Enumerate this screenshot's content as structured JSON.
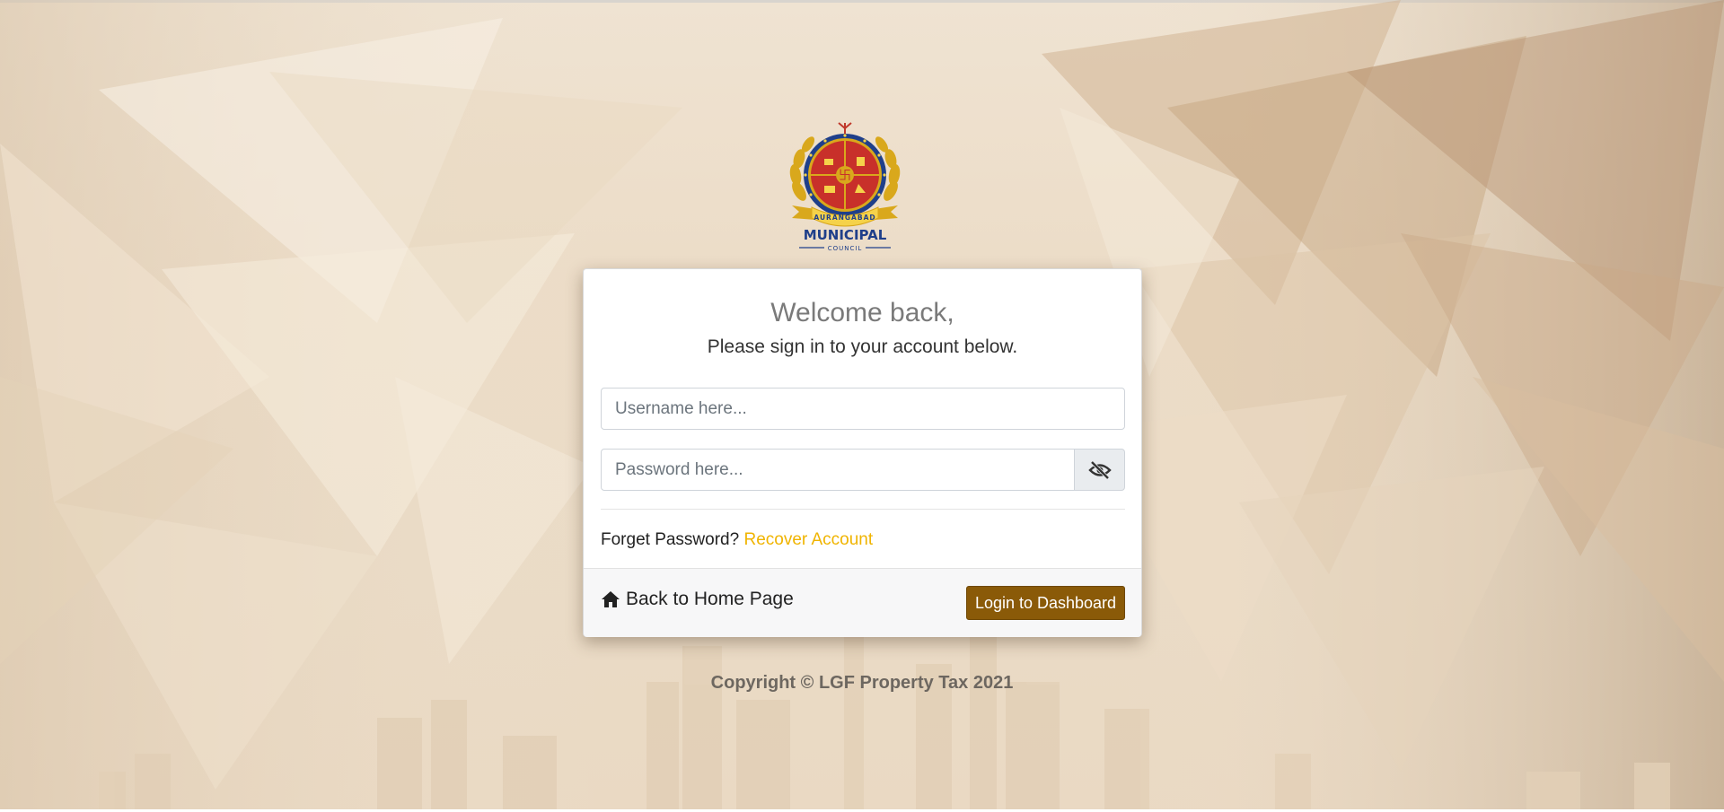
{
  "logo": {
    "icon": "aurangabad-municipal-council-emblem",
    "ribbon_text": "AURANGABAD",
    "name": "MUNICIPAL",
    "sub": "COUNCIL"
  },
  "login": {
    "welcome": "Welcome back,",
    "subtitle": "Please sign in to your account below.",
    "username_placeholder": "Username here...",
    "password_placeholder": "Password here...",
    "toggle_icon": "eye-slash-icon",
    "forgot_label": "Forget Password?",
    "recover_label": "Recover Account",
    "home_icon": "home-icon",
    "home_label": "Back to Home Page",
    "login_button": "Login to Dashboard"
  },
  "footer": {
    "copyright": "Copyright © LGF Property Tax 2021"
  },
  "colors": {
    "accent_link": "#f0b400",
    "button": "#8a5a08",
    "background": "#ecdcc7"
  }
}
